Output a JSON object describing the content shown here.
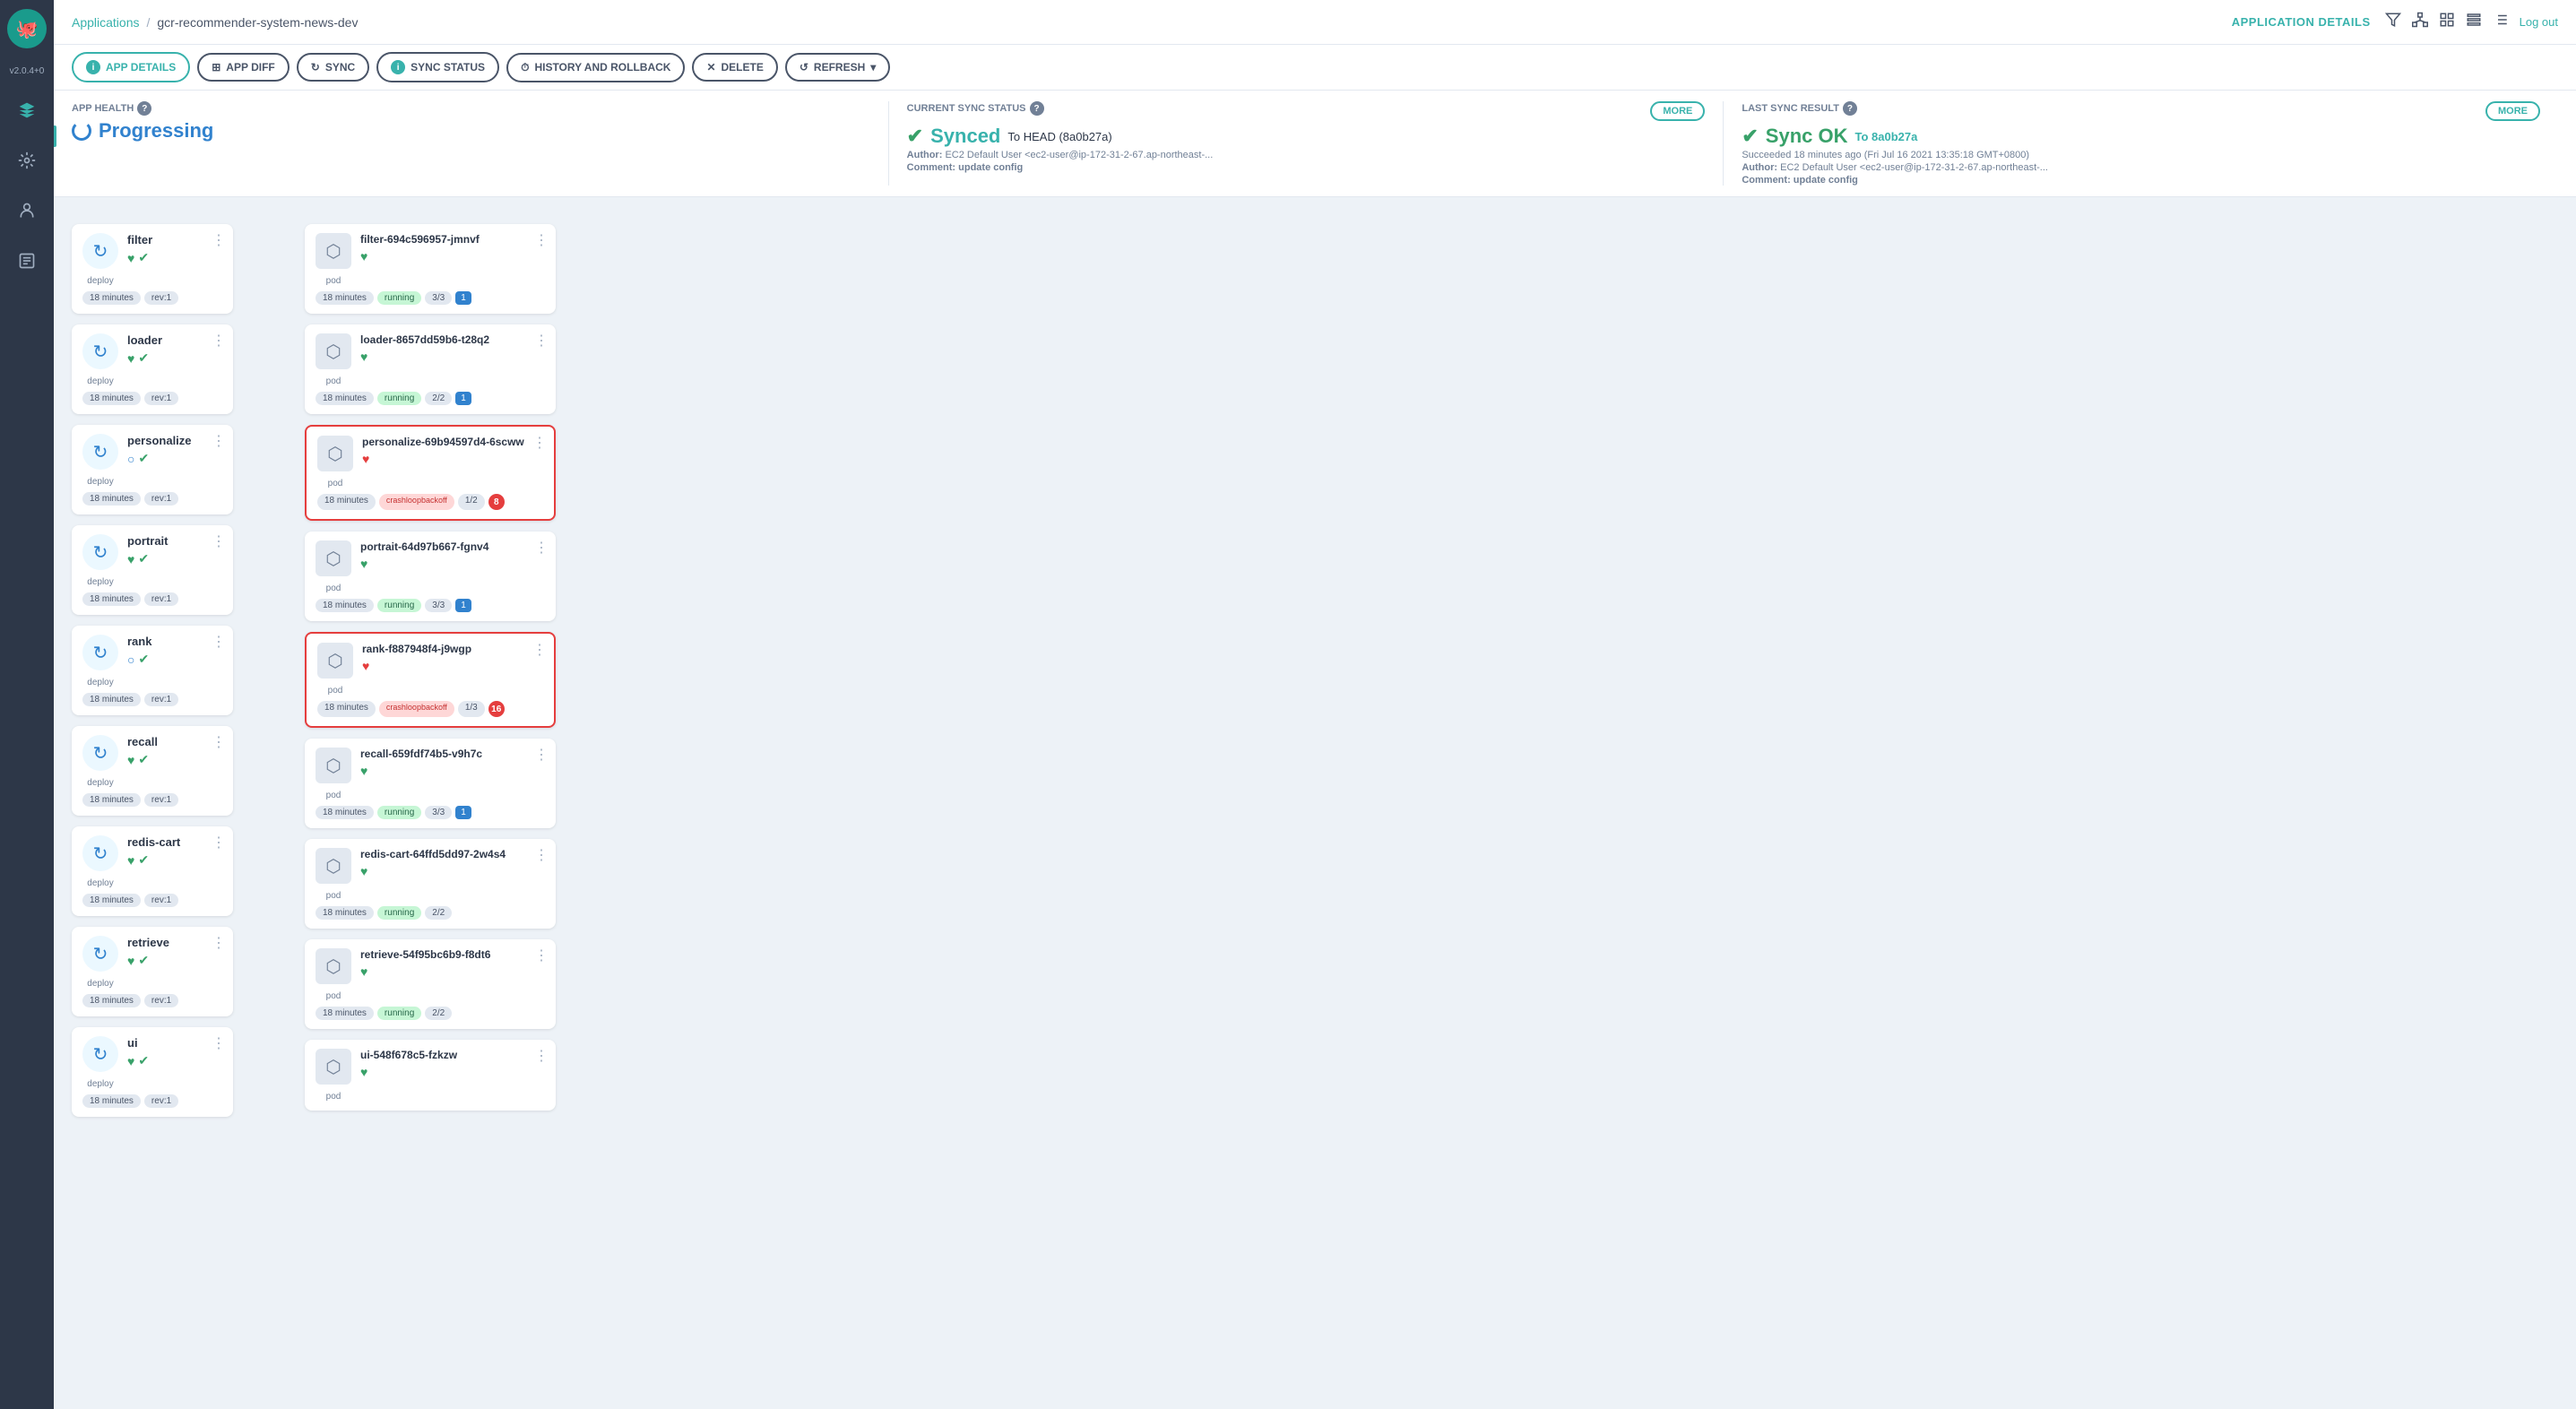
{
  "sidebar": {
    "version": "v2.0.4+0",
    "items": [
      {
        "id": "logo",
        "icon": "🐙"
      },
      {
        "id": "layers",
        "icon": "◱"
      },
      {
        "id": "settings",
        "icon": "⚙"
      },
      {
        "id": "user",
        "icon": "👤"
      },
      {
        "id": "docs",
        "icon": "📋"
      }
    ]
  },
  "breadcrumb": {
    "link": "Applications",
    "separator": "/",
    "current": "gcr-recommender-system-news-dev"
  },
  "topbar": {
    "app_details": "APPLICATION DETAILS",
    "logout": "Log out"
  },
  "toolbar": {
    "buttons": [
      {
        "id": "app-details",
        "icon": "ℹ",
        "label": "APP DETAILS"
      },
      {
        "id": "app-diff",
        "icon": "⊞",
        "label": "APP DIFF"
      },
      {
        "id": "sync",
        "icon": "↻",
        "label": "SYNC"
      },
      {
        "id": "sync-status",
        "icon": "ℹ",
        "label": "SYNC STATUS"
      },
      {
        "id": "history",
        "icon": "⏱",
        "label": "HISTORY AND ROLLBACK"
      },
      {
        "id": "delete",
        "icon": "✕",
        "label": "DELETE"
      },
      {
        "id": "refresh",
        "icon": "↺",
        "label": "REFRESH",
        "has_dropdown": true
      }
    ]
  },
  "status": {
    "app_health": {
      "label": "APP HEALTH",
      "value": "Progressing",
      "icon": "circle"
    },
    "sync_status": {
      "label": "CURRENT SYNC STATUS",
      "more": "MORE",
      "value": "Synced",
      "to": "To HEAD (8a0b27a)",
      "author_label": "Author:",
      "author": "EC2 Default User <ec2-user@ip-172-31-2-67.ap-northeast-...",
      "comment_label": "Comment:",
      "comment": "update config"
    },
    "last_sync": {
      "label": "LAST SYNC RESULT",
      "more": "MORE",
      "value": "Sync OK",
      "to": "To 8a0b27a",
      "succeeded": "Succeeded 18 minutes ago (Fri Jul 16 2021 13:35:18 GMT+0800)",
      "author_label": "Author:",
      "author": "EC2 Default User <ec2-user@ip-172-31-2-67.ap-northeast-...",
      "comment_label": "Comment:",
      "comment": "update config"
    }
  },
  "deployments": [
    {
      "name": "filter",
      "health": "green-green",
      "time": "18 minutes",
      "rev": "rev:1"
    },
    {
      "name": "loader",
      "health": "green-green",
      "time": "18 minutes",
      "rev": "rev:1"
    },
    {
      "name": "personalize",
      "health": "circle-green",
      "time": "18 minutes",
      "rev": "rev:1"
    },
    {
      "name": "portrait",
      "health": "green-green",
      "time": "18 minutes",
      "rev": "rev:1"
    },
    {
      "name": "rank",
      "health": "circle-green",
      "time": "18 minutes",
      "rev": "rev:1"
    },
    {
      "name": "recall",
      "health": "green-green",
      "time": "18 minutes",
      "rev": "rev:1"
    },
    {
      "name": "redis-cart",
      "health": "green-green",
      "time": "18 minutes",
      "rev": "rev:1"
    },
    {
      "name": "retrieve",
      "health": "green-green",
      "time": "18 minutes",
      "rev": "rev:1"
    },
    {
      "name": "ui",
      "health": "green-green",
      "time": "18 minutes",
      "rev": "rev:1"
    }
  ],
  "pods": [
    {
      "name": "filter-694c596957-jmnvf",
      "health": "heart-green",
      "time": "18 minutes",
      "status": "running",
      "ratio": "3/3",
      "num": "1",
      "error": false
    },
    {
      "name": "loader-8657dd59b6-t28q2",
      "health": "heart-green",
      "time": "18 minutes",
      "status": "running",
      "ratio": "2/2",
      "num": "1",
      "error": false
    },
    {
      "name": "personalize-69b94597d4-6scww",
      "health": "heart-red",
      "time": "18 minutes",
      "status": "crashloopbackoff",
      "ratio": "1/2",
      "num": "8",
      "error": true
    },
    {
      "name": "portrait-64d97b667-fgnv4",
      "health": "heart-green",
      "time": "18 minutes",
      "status": "running",
      "ratio": "3/3",
      "num": "1",
      "error": false
    },
    {
      "name": "rank-f887948f4-j9wgp",
      "health": "heart-red",
      "time": "18 minutes",
      "status": "crashloopbackoff",
      "ratio": "1/3",
      "num": "16",
      "error": true
    },
    {
      "name": "recall-659fdf74b5-v9h7c",
      "health": "heart-green",
      "time": "18 minutes",
      "status": "running",
      "ratio": "3/3",
      "num": "1",
      "error": false
    },
    {
      "name": "redis-cart-64ffd5dd97-2w4s4",
      "health": "heart-green",
      "time": "18 minutes",
      "status": "running",
      "ratio": "2/2",
      "num": null,
      "error": false
    },
    {
      "name": "retrieve-54f95bc6b9-f8dt6",
      "health": "heart-green",
      "time": "18 minutes",
      "status": "running",
      "ratio": "2/2",
      "num": null,
      "error": false
    },
    {
      "name": "ui-548f678c5-fzkzw",
      "health": "heart-green",
      "time": "18 minutes",
      "status": null,
      "ratio": null,
      "num": null,
      "error": false
    }
  ]
}
